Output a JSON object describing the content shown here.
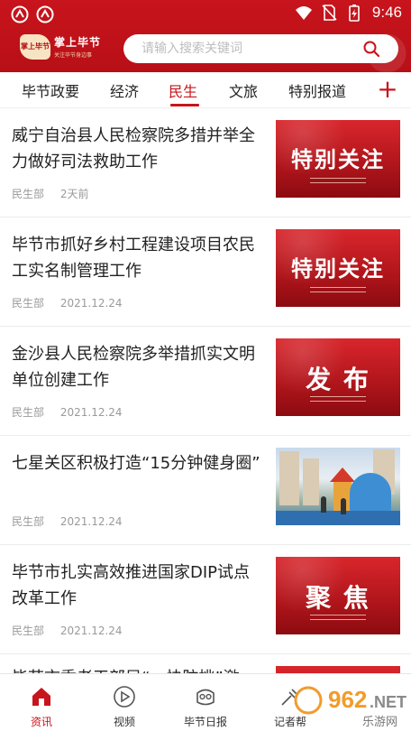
{
  "status_bar": {
    "time": "9:46",
    "left_icons": [
      "app-notification-icon",
      "app-notification-icon"
    ],
    "right_icons": [
      "wifi-icon",
      "no-sim-icon",
      "battery-charging-icon"
    ]
  },
  "header": {
    "logo_badge": "掌上毕节",
    "logo_title": "掌上毕节",
    "logo_subtitle": "关注毕节身边事",
    "search_placeholder": "请输入搜索关键词",
    "accent_color": "#c8141c"
  },
  "tabs": [
    {
      "label": "毕节政要",
      "active": false
    },
    {
      "label": "经济",
      "active": false
    },
    {
      "label": "民生",
      "active": true
    },
    {
      "label": "文旅",
      "active": false
    },
    {
      "label": "特别报道",
      "active": false
    }
  ],
  "add_tab_label": "+",
  "news": [
    {
      "title": "威宁自治县人民检察院多措并举全力做好司法救助工作",
      "source": "民生部",
      "time": "2天前",
      "thumb_text": "特别关注"
    },
    {
      "title": "毕节市抓好乡村工程建设项目农民工实名制管理工作",
      "source": "民生部",
      "time": "2021.12.24",
      "thumb_text": "特别关注"
    },
    {
      "title": "金沙县人民检察院多举措抓实文明单位创建工作",
      "source": "民生部",
      "time": "2021.12.24",
      "thumb_text": "发 布"
    },
    {
      "title": "七星关区积极打造“15分钟健身圈”",
      "source": "民生部",
      "time": "2021.12.24",
      "thumb_text": ""
    },
    {
      "title": "毕节市扎实高效推进国家DIP试点改革工作",
      "source": "民生部",
      "time": "2021.12.24",
      "thumb_text": "聚 焦"
    }
  ],
  "partial_item_title": "毕节市委老干部局“一快防挑”激",
  "bottom_nav": [
    {
      "label": "资讯",
      "icon": "home-icon",
      "active": true
    },
    {
      "label": "视频",
      "icon": "play-icon",
      "active": false
    },
    {
      "label": "毕节日报",
      "icon": "newspaper-icon",
      "active": false
    },
    {
      "label": "记者帮",
      "icon": "reporter-icon",
      "active": false
    }
  ],
  "watermark": "962.NET 乐游网"
}
